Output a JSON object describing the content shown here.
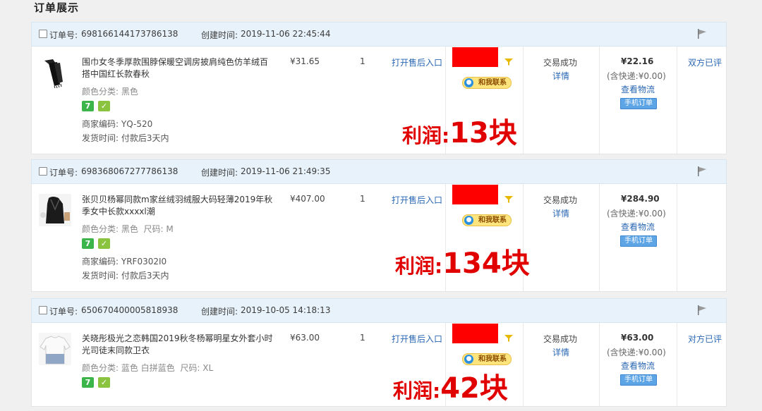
{
  "page": {
    "title": "订单展示"
  },
  "labels": {
    "order_no": "订单号:",
    "created": "创建时间:",
    "color_class": "颜色分类:",
    "size": "尺码:",
    "merchant_code": "商家编码:",
    "ship_time": "发货时间:",
    "after_sale": "打开售后入口",
    "contact": "和我联系",
    "detail": "详情",
    "logistics": "查看物流",
    "mobile_order": "手机订单",
    "badge_seven": "7",
    "profit_label": "利润:"
  },
  "colors": {
    "profit": "#e10000",
    "link": "#2a67b3",
    "header_bg": "#e8f2fa",
    "redaction": "#ff0000"
  },
  "orders": [
    {
      "order_no": "698166144173786138",
      "created": "2019-11-06 22:45:44",
      "title": "围巾女冬季厚款围脖保暖空调房披肩纯色仿羊绒百搭中国红长款春秋",
      "color": "黑色",
      "size": "",
      "merchant_code": "YQ-520",
      "ship_time": "付款后3天内",
      "price": "¥31.65",
      "qty": "1",
      "status": "交易成功",
      "total": "¥22.16",
      "shipping": "(含快递:¥0.00)",
      "review": "双方已评",
      "profit_value": "13块",
      "thumb_icon": "scarf-thumbnail"
    },
    {
      "order_no": "698368067277786138",
      "created": "2019-11-06 21:49:35",
      "title": "张贝贝杨幂同款m家丝绒羽绒服大码轻薄2019年秋季女中长款xxxxl潮",
      "color": "黑色",
      "size": "M",
      "merchant_code": "YRF0302I0",
      "ship_time": "付款后3天内",
      "price": "¥407.00",
      "qty": "1",
      "status": "交易成功",
      "total": "¥284.90",
      "shipping": "(含快递:¥0.00)",
      "review": "",
      "profit_value": "134块",
      "thumb_icon": "down-jacket-thumbnail"
    },
    {
      "order_no": "650670400005818938",
      "created": "2019-10-05 14:18:13",
      "title": "关晓彤极光之恋韩国2019秋冬杨幂明星女外套小时光司徒末同款卫衣",
      "color": "蓝色 白拼蓝色",
      "size": "XL",
      "merchant_code": "",
      "ship_time": "",
      "price": "¥63.00",
      "qty": "1",
      "status": "交易成功",
      "total": "¥63.00",
      "shipping": "(含快递:¥0.00)",
      "review": "对方已评",
      "profit_value": "42块",
      "thumb_icon": "sweatshirt-thumbnail"
    }
  ]
}
